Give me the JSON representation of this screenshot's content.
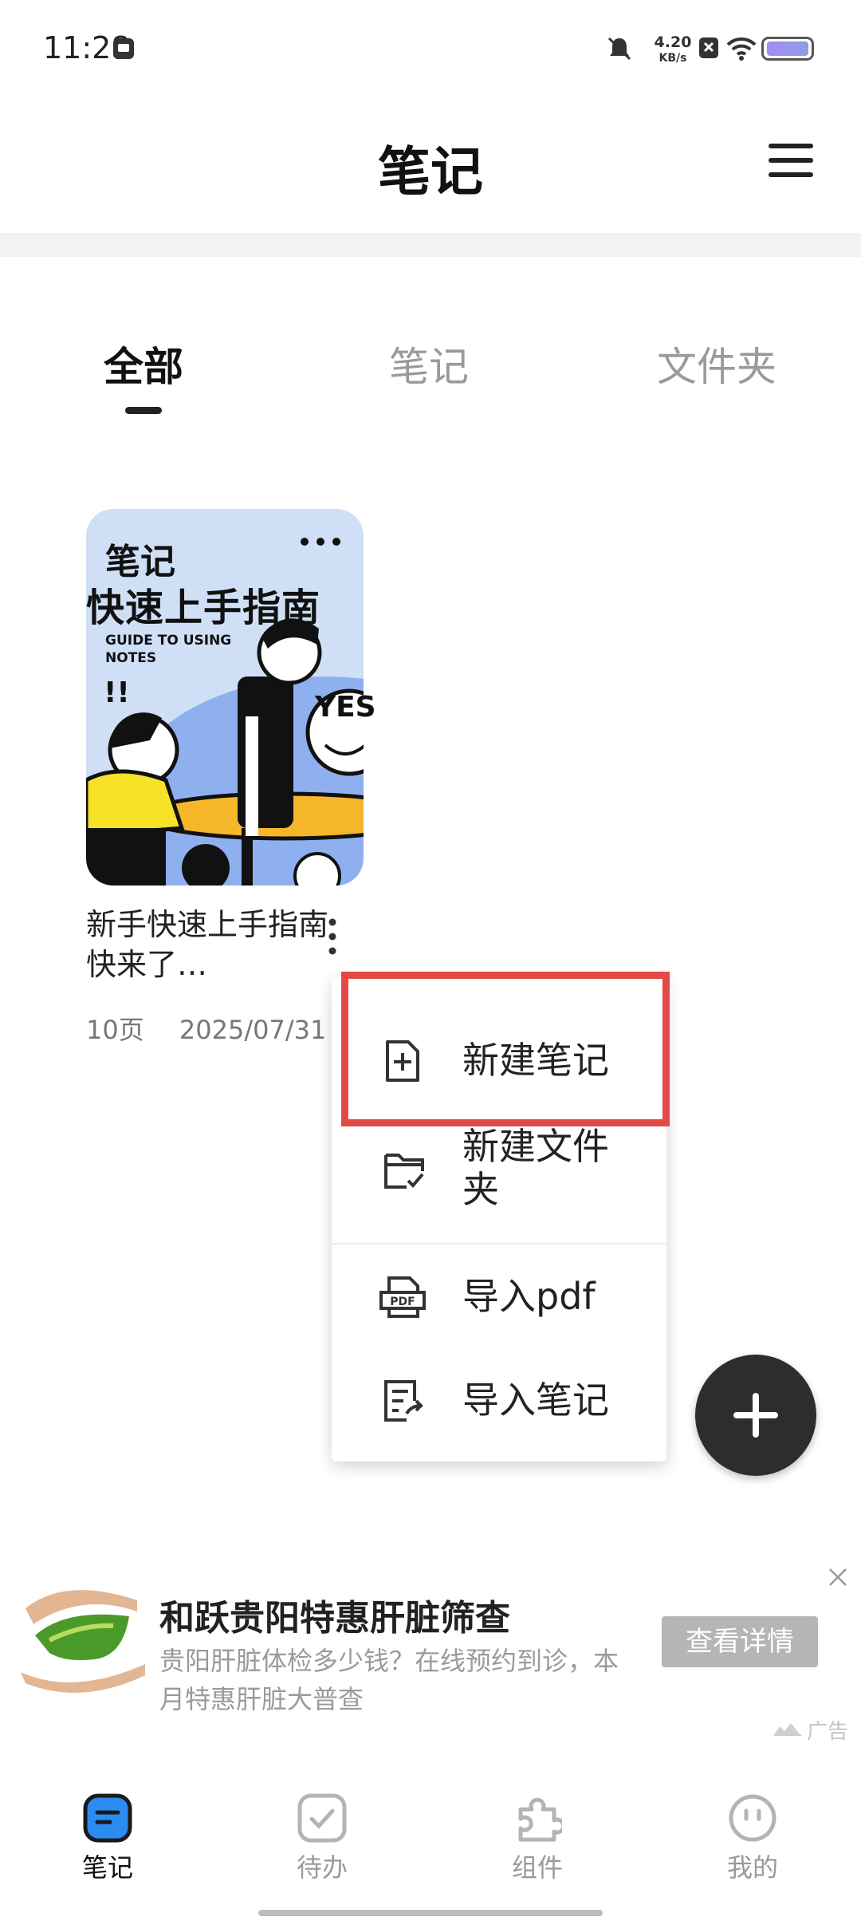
{
  "status_bar": {
    "time": "11:28",
    "net_speed_value": "4.20",
    "net_speed_unit": "KB/s"
  },
  "header": {
    "title": "笔记"
  },
  "tabs": [
    {
      "label": "全部",
      "active": true
    },
    {
      "label": "笔记",
      "active": false
    },
    {
      "label": "文件夹",
      "active": false
    }
  ],
  "note": {
    "cover_title_line1": "笔记",
    "cover_title_line2": "快速上手指南",
    "cover_subtitle": "GUIDE TO USING NOTES",
    "cover_exclaim": "!!",
    "cover_bubble": "YES",
    "name": "新手快速上手指南快来了…",
    "pages": "10页",
    "date": "2025/07/31"
  },
  "menu": {
    "items": [
      {
        "label": "新建笔记",
        "icon": "new-note-icon"
      },
      {
        "label": "新建文件夹",
        "icon": "new-folder-icon"
      },
      {
        "label": "导入pdf",
        "icon": "pdf-icon"
      },
      {
        "label": "导入笔记",
        "icon": "import-note-icon"
      }
    ]
  },
  "ad": {
    "title": "和跃贵阳特惠肝脏筛查",
    "text": "贵阳肝脏体检多少钱？在线预约到诊，本月特惠肝脏大普查",
    "button": "查看详情",
    "label": "广告"
  },
  "bottom_nav": [
    {
      "label": "笔记",
      "icon": "notes-icon",
      "active": true
    },
    {
      "label": "待办",
      "icon": "todo-icon",
      "active": false
    },
    {
      "label": "组件",
      "icon": "widgets-icon",
      "active": false
    },
    {
      "label": "我的",
      "icon": "profile-icon",
      "active": false
    }
  ],
  "colors": {
    "accent": "#2a8cf0",
    "highlight": "#e24a47",
    "fab": "#2d2d2d"
  }
}
